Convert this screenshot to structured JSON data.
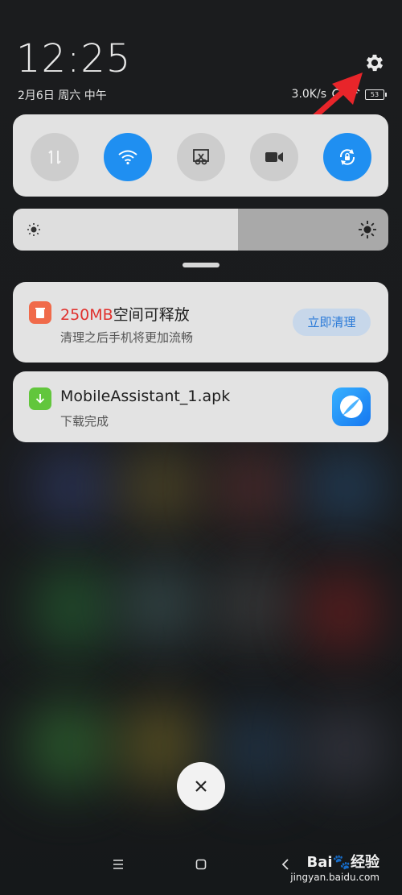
{
  "status_bar": {
    "time": "12:25",
    "date": "2月6日 周六 中午",
    "net_speed": "3.0K/s",
    "battery": "53"
  },
  "quick_settings": {
    "toggles": [
      {
        "name": "mobile-data",
        "state": "off"
      },
      {
        "name": "wifi",
        "state": "on"
      },
      {
        "name": "screenshot",
        "state": "off"
      },
      {
        "name": "screen-recorder",
        "state": "off"
      },
      {
        "name": "auto-rotate",
        "state": "on"
      }
    ],
    "brightness_level": 0.6
  },
  "notifications": [
    {
      "title_highlight": "250MB",
      "title_rest": "空间可释放",
      "subtitle": "清理之后手机将更加流畅",
      "action_label": "立即清理",
      "icon": "trash-icon",
      "icon_color": "#f06a4a"
    },
    {
      "title": "MobileAssistant_1.apk",
      "subtitle": "下载完成",
      "icon": "download-icon",
      "icon_color": "#62c63c",
      "app_icon": "browser-icon"
    }
  ],
  "watermark": {
    "logo": "Bai🐾经验",
    "url": "jingyan.baidu.com"
  },
  "colors": {
    "accent": "#1f8ff1",
    "highlight": "#e0312d",
    "arrow": "#e8252a"
  }
}
